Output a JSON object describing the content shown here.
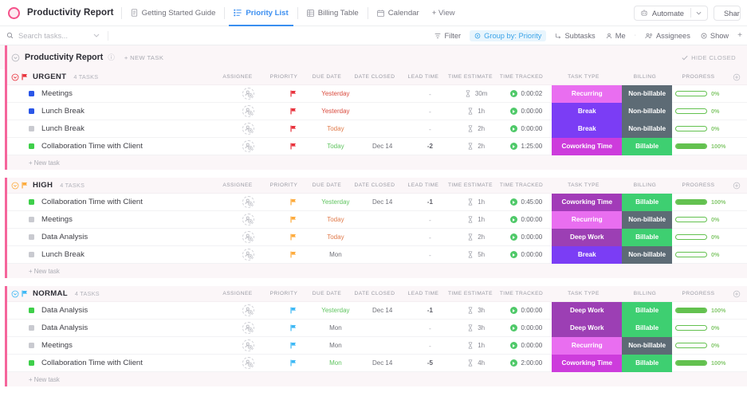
{
  "topbar": {
    "doc_title": "Productivity Report",
    "tabs": [
      {
        "label": "Getting Started Guide",
        "icon": "doc-icon",
        "active": false
      },
      {
        "label": "Priority List",
        "icon": "list-icon",
        "active": true
      },
      {
        "label": "Billing Table",
        "icon": "table-icon",
        "active": false
      },
      {
        "label": "Calendar",
        "icon": "calendar-icon",
        "active": false
      }
    ],
    "add_view": "+ View",
    "automate": "Automate",
    "share": "Shar"
  },
  "filterbar": {
    "search_placeholder": "Search tasks...",
    "items": [
      {
        "label": "Filter",
        "icon": "filter-icon",
        "active": false
      },
      {
        "label": "Group by: Priority",
        "icon": "group-icon",
        "active": true
      },
      {
        "label": "Subtasks",
        "icon": "subtask-icon",
        "active": false
      },
      {
        "label": "Me",
        "icon": "person-icon",
        "active": false
      },
      {
        "label": "Assignees",
        "icon": "assignees-icon",
        "active": false
      },
      {
        "label": "Show",
        "icon": "eye-icon",
        "active": false
      }
    ]
  },
  "list_header": {
    "title": "Productivity Report",
    "new_task": "+ NEW TASK",
    "hide_closed": "HIDE CLOSED"
  },
  "columns": [
    "ASSIGNEE",
    "PRIORITY",
    "DUE DATE",
    "DATE CLOSED",
    "LEAD TIME",
    "TIME ESTIMATE",
    "TIME TRACKED",
    "TASK TYPE",
    "BILLING",
    "PROGRESS"
  ],
  "new_task_label": "+ New task",
  "colors": {
    "accent_pink": "#f5659b",
    "urgent": "#e8323c",
    "high": "#fdab3d",
    "normal": "#3db8f5",
    "recurring": "#e96ef0",
    "break": "#7b3df5",
    "coworking": "#cd3cdc",
    "deep_work": "#9c3fb4",
    "billable": "#3ecf71",
    "non_billable": "#5d6b75",
    "progress_green": "#63c14f"
  },
  "groups": [
    {
      "name": "URGENT",
      "count": "4 TASKS",
      "flag_color": "#e8323c",
      "chevron_color": "#e8323c",
      "tasks": [
        {
          "status_color": "#2a56e8",
          "name": "Meetings",
          "priority_color": "#e8323c",
          "due": "Yesterday",
          "due_color": "#d94a3d",
          "closed": "",
          "lead": "-",
          "estimate": "30m",
          "tracked": "0:00:02",
          "type": "Recurring",
          "type_color": "#e96ef0",
          "billing": "Non-billable",
          "billing_color": "#5d6b75",
          "progress": 0,
          "progress_label": "0%"
        },
        {
          "status_color": "#2a56e8",
          "name": "Lunch Break",
          "priority_color": "#e8323c",
          "due": "Yesterday",
          "due_color": "#d94a3d",
          "closed": "",
          "lead": "-",
          "estimate": "1h",
          "tracked": "0:00:00",
          "type": "Break",
          "type_color": "#7b3df5",
          "billing": "Non-billable",
          "billing_color": "#5d6b75",
          "progress": 0,
          "progress_label": "0%"
        },
        {
          "status_color": "#c9cad0",
          "name": "Lunch Break",
          "priority_color": "#e8323c",
          "due": "Today",
          "due_color": "#e07a4a",
          "closed": "",
          "lead": "-",
          "estimate": "2h",
          "tracked": "0:00:00",
          "type": "Break",
          "type_color": "#7b3df5",
          "billing": "Non-billable",
          "billing_color": "#5d6b75",
          "progress": 0,
          "progress_label": "0%"
        },
        {
          "status_color": "#3ecf4a",
          "name": "Collaboration Time with Client",
          "priority_color": "#e8323c",
          "due": "Today",
          "due_color": "#5fc45f",
          "closed": "Dec 14",
          "lead": "-2",
          "estimate": "2h",
          "tracked": "1:25:00",
          "type": "Coworking Time",
          "type_color": "#cd3cdc",
          "billing": "Billable",
          "billing_color": "#3ecf71",
          "progress": 100,
          "progress_label": "100%"
        }
      ]
    },
    {
      "name": "HIGH",
      "count": "4 TASKS",
      "flag_color": "#fdab3d",
      "chevron_color": "#fdab3d",
      "tasks": [
        {
          "status_color": "#3ecf4a",
          "name": "Collaboration Time with Client",
          "priority_color": "#fdab3d",
          "due": "Yesterday",
          "due_color": "#5fc45f",
          "closed": "Dec 14",
          "lead": "-1",
          "estimate": "1h",
          "tracked": "0:45:00",
          "type": "Coworking Time",
          "type_color": "#a23bb8",
          "billing": "Billable",
          "billing_color": "#3ecf71",
          "progress": 100,
          "progress_label": "100%"
        },
        {
          "status_color": "#c9cad0",
          "name": "Meetings",
          "priority_color": "#fdab3d",
          "due": "Today",
          "due_color": "#e07a4a",
          "closed": "",
          "lead": "-",
          "estimate": "1h",
          "tracked": "0:00:00",
          "type": "Recurring",
          "type_color": "#e96ef0",
          "billing": "Non-billable",
          "billing_color": "#5d6b75",
          "progress": 0,
          "progress_label": "0%"
        },
        {
          "status_color": "#c9cad0",
          "name": "Data Analysis",
          "priority_color": "#fdab3d",
          "due": "Today",
          "due_color": "#e07a4a",
          "closed": "",
          "lead": "-",
          "estimate": "2h",
          "tracked": "0:00:00",
          "type": "Deep Work",
          "type_color": "#9c3fb4",
          "billing": "Billable",
          "billing_color": "#3ecf71",
          "progress": 0,
          "progress_label": "0%"
        },
        {
          "status_color": "#c9cad0",
          "name": "Lunch Break",
          "priority_color": "#fdab3d",
          "due": "Mon",
          "due_color": "#6f7078",
          "closed": "",
          "lead": "-",
          "estimate": "5h",
          "tracked": "0:00:00",
          "type": "Break",
          "type_color": "#7b3df5",
          "billing": "Non-billable",
          "billing_color": "#5d6b75",
          "progress": 0,
          "progress_label": "0%"
        }
      ]
    },
    {
      "name": "NORMAL",
      "count": "4 TASKS",
      "flag_color": "#3db8f5",
      "chevron_color": "#3db8f5",
      "tasks": [
        {
          "status_color": "#3ecf4a",
          "name": "Data Analysis",
          "priority_color": "#3db8f5",
          "due": "Yesterday",
          "due_color": "#5fc45f",
          "closed": "Dec 14",
          "lead": "-1",
          "estimate": "3h",
          "tracked": "0:00:00",
          "type": "Deep Work",
          "type_color": "#9c3fb4",
          "billing": "Billable",
          "billing_color": "#3ecf71",
          "progress": 100,
          "progress_label": "100%"
        },
        {
          "status_color": "#c9cad0",
          "name": "Data Analysis",
          "priority_color": "#3db8f5",
          "due": "Mon",
          "due_color": "#6f7078",
          "closed": "",
          "lead": "-",
          "estimate": "3h",
          "tracked": "0:00:00",
          "type": "Deep Work",
          "type_color": "#9c3fb4",
          "billing": "Billable",
          "billing_color": "#3ecf71",
          "progress": 0,
          "progress_label": "0%"
        },
        {
          "status_color": "#c9cad0",
          "name": "Meetings",
          "priority_color": "#3db8f5",
          "due": "Mon",
          "due_color": "#6f7078",
          "closed": "",
          "lead": "-",
          "estimate": "1h",
          "tracked": "0:00:00",
          "type": "Recurring",
          "type_color": "#e96ef0",
          "billing": "Non-billable",
          "billing_color": "#5d6b75",
          "progress": 0,
          "progress_label": "0%"
        },
        {
          "status_color": "#3ecf4a",
          "name": "Collaboration Time with Client",
          "priority_color": "#3db8f5",
          "due": "Mon",
          "due_color": "#5fc45f",
          "closed": "Dec 14",
          "lead": "-5",
          "estimate": "4h",
          "tracked": "2:00:00",
          "type": "Coworking Time",
          "type_color": "#cd3cdc",
          "billing": "Billable",
          "billing_color": "#3ecf71",
          "progress": 100,
          "progress_label": "100%"
        }
      ]
    }
  ]
}
